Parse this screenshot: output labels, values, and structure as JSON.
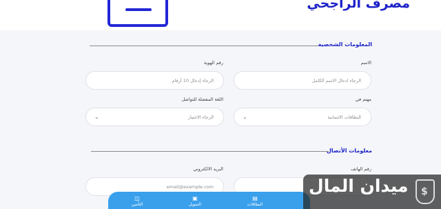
{
  "header": {
    "brand_name": "مصرف الراجحي",
    "doc_icon": "document-icon"
  },
  "personal_section": {
    "title": "المعلومات الشخصية",
    "name_label": "الاسم",
    "name_placeholder": "الرجاء ادخال الاسم الكامل",
    "id_label": "رقم الهوية",
    "id_placeholder": "الرجاء إدخال 10 أرقام",
    "interest_label": "مهتم في",
    "interest_value": "البطاقات الائتمانية",
    "language_label": "اللغة المفضلة للتواصل",
    "language_value": "الرجاء الاختيار"
  },
  "contact_section": {
    "title": "معلومات الأتصال",
    "phone_label": "رقم الهاتف",
    "email_label": "البريد الالكتروني",
    "email_placeholder": "email@example.com"
  },
  "bottom_nav": {
    "items": [
      {
        "label": "التأمين",
        "icon": "shield-document-icon"
      },
      {
        "label": "التمويل",
        "icon": "money-icon"
      },
      {
        "label": "البطاقات",
        "icon": "card-icon"
      }
    ]
  },
  "watermark": {
    "text": "ميدان المال",
    "icon": "shield-dollar-icon"
  },
  "colors": {
    "brand_blue": "#1c22c8",
    "nav_blue": "#3aa0ec"
  }
}
